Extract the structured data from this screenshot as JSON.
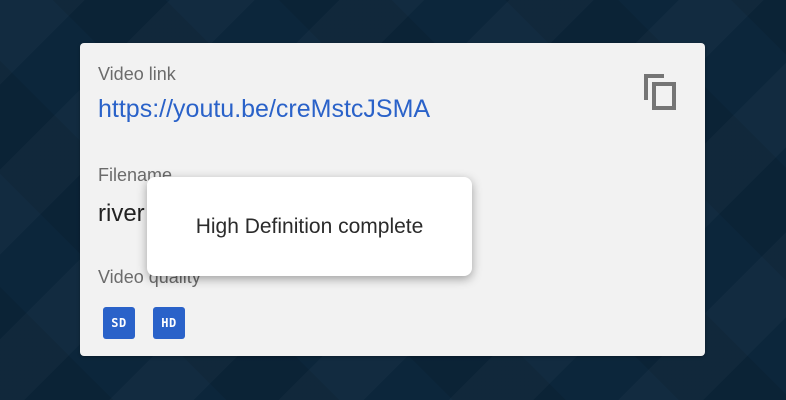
{
  "card": {
    "video_link_label": "Video link",
    "video_link_url": "https://youtu.be/creMstcJSMA",
    "filename_label": "Filename",
    "filename_value": "river",
    "video_quality_label": "Video quality",
    "qualities": [
      "SD",
      "HD"
    ],
    "copy_icon": "copy-icon"
  },
  "toast": {
    "message": "High Definition complete"
  },
  "colors": {
    "accent": "#2a62c9",
    "background": "#0c263b",
    "card": "#f2f2f2"
  }
}
